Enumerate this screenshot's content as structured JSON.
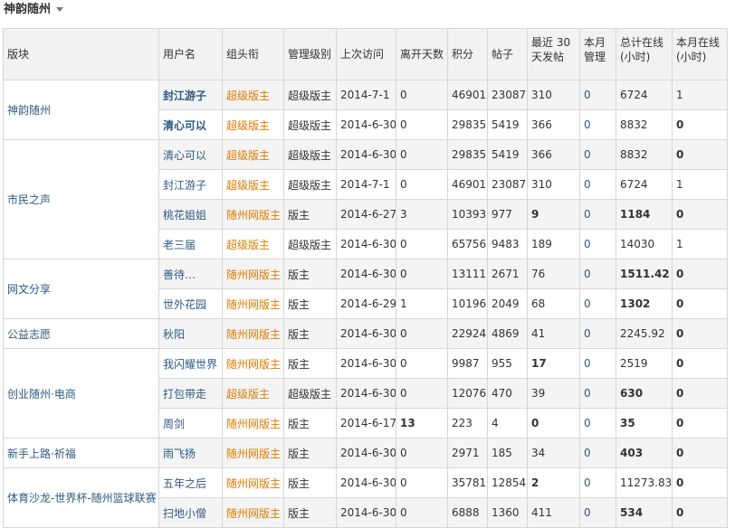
{
  "page": {
    "title": "神韵随州"
  },
  "columns": [
    "版块",
    "用户名",
    "组头衔",
    "管理级别",
    "上次访问",
    "离开天数",
    "积分",
    "帖子",
    "最近 30 天发帖",
    "本月管理",
    "总计在线(小时)",
    "本月在线(小时)"
  ],
  "header": {
    "board": "版块",
    "user": "用户名",
    "group": "组头衔",
    "level": "管理级别",
    "visit": "上次访问",
    "away": "离开天数",
    "credits": "积分",
    "posts": "帖子",
    "recent_line1": "最近 30",
    "recent_line2": "天发帖",
    "manage_line1": "本月",
    "manage_line2": "管理",
    "total_line1": "总计在线",
    "total_line2": "(小时)",
    "month_line1": "本月在线",
    "month_line2": "(小时)"
  },
  "boards": [
    {
      "name": "神韵随州",
      "rows": [
        {
          "user": "封江游子",
          "group": "超级版主",
          "level": "超级版主",
          "visit": "2014-7-1",
          "away": "0",
          "credits": "46901",
          "posts": "23087",
          "recent": "310",
          "manage": "0",
          "total": "6724",
          "month": "1"
        },
        {
          "user": "清心可以",
          "group": "超级版主",
          "level": "超级版主",
          "visit": "2014-6-30",
          "away": "0",
          "credits": "29835",
          "posts": "5419",
          "recent": "366",
          "manage": "0",
          "total": "8832",
          "month": "0"
        }
      ]
    },
    {
      "name": "市民之声",
      "rows": [
        {
          "user": "清心可以",
          "group": "超级版主",
          "level": "超级版主",
          "visit": "2014-6-30",
          "away": "0",
          "credits": "29835",
          "posts": "5419",
          "recent": "366",
          "manage": "0",
          "total": "8832",
          "month": "0"
        },
        {
          "user": "封江游子",
          "group": "超级版主",
          "level": "超级版主",
          "visit": "2014-7-1",
          "away": "0",
          "credits": "46901",
          "posts": "23087",
          "recent": "310",
          "manage": "0",
          "total": "6724",
          "month": "1"
        },
        {
          "user": "桃花姐姐",
          "group": "随州网版主",
          "level": "版主",
          "visit": "2014-6-27",
          "away": "3",
          "credits": "10393",
          "posts": "977",
          "recent": "9",
          "manage": "0",
          "total": "1184",
          "month": "0"
        },
        {
          "user": "老三届",
          "group": "超级版主",
          "level": "超级版主",
          "visit": "2014-6-30",
          "away": "0",
          "credits": "65756",
          "posts": "9483",
          "recent": "189",
          "manage": "0",
          "total": "14030",
          "month": "1"
        }
      ]
    },
    {
      "name": "网文分享",
      "rows": [
        {
          "user": "善待…",
          "group": "随州网版主",
          "level": "版主",
          "visit": "2014-6-30",
          "away": "0",
          "credits": "13111",
          "posts": "2671",
          "recent": "76",
          "manage": "0",
          "total": "1511.42",
          "month": "0"
        },
        {
          "user": "世外花园",
          "group": "随州网版主",
          "level": "版主",
          "visit": "2014-6-29",
          "away": "1",
          "credits": "10196",
          "posts": "2049",
          "recent": "68",
          "manage": "0",
          "total": "1302",
          "month": "0"
        }
      ]
    },
    {
      "name": "公益志愿",
      "rows": [
        {
          "user": "秋阳",
          "group": "随州网版主",
          "level": "版主",
          "visit": "2014-6-30",
          "away": "0",
          "credits": "22924",
          "posts": "4869",
          "recent": "41",
          "manage": "0",
          "total": "2245.92",
          "month": "0"
        }
      ]
    },
    {
      "name": "创业随州·电商",
      "rows": [
        {
          "user": "我闪耀世界",
          "group": "随州网版主",
          "level": "版主",
          "visit": "2014-6-30",
          "away": "0",
          "credits": "9987",
          "posts": "955",
          "recent": "17",
          "manage": "0",
          "total": "2519",
          "month": "0"
        },
        {
          "user": "打包带走",
          "group": "超级版主",
          "level": "超级版主",
          "visit": "2014-6-30",
          "away": "0",
          "credits": "12076",
          "posts": "470",
          "recent": "39",
          "manage": "0",
          "total": "630",
          "month": "0"
        },
        {
          "user": "周剑",
          "group": "随州网版主",
          "level": "版主",
          "visit": "2014-6-17",
          "away": "13",
          "credits": "223",
          "posts": "4",
          "recent": "0",
          "manage": "0",
          "total": "35",
          "month": "0"
        }
      ]
    },
    {
      "name": "新手上路·祈福",
      "rows": [
        {
          "user": "雨飞扬",
          "group": "随州网版主",
          "level": "版主",
          "visit": "2014-6-30",
          "away": "0",
          "credits": "2971",
          "posts": "185",
          "recent": "34",
          "manage": "0",
          "total": "403",
          "month": "0"
        }
      ]
    },
    {
      "name": "体育沙龙-世界杯-随州篮球联赛",
      "rows": [
        {
          "user": "五年之后",
          "group": "随州网版主",
          "level": "版主",
          "visit": "2014-6-30",
          "away": "0",
          "credits": "35781",
          "posts": "12854",
          "recent": "2",
          "manage": "0",
          "total": "11273.83",
          "month": "0"
        },
        {
          "user": "扫地小僧",
          "group": "随州网版主",
          "level": "版主",
          "visit": "2014-6-30",
          "away": "0",
          "credits": "6888",
          "posts": "1360",
          "recent": "411",
          "manage": "0",
          "total": "534",
          "month": "0"
        }
      ]
    }
  ],
  "colors": {
    "link": "#2c5a83",
    "group": "#e07a00",
    "header_bg": "#f2f2f2",
    "border": "#d6d6d6"
  }
}
